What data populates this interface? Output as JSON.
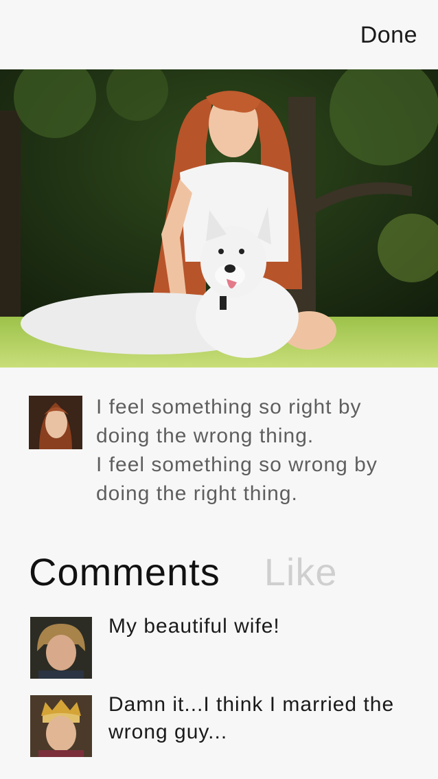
{
  "nav": {
    "done_label": "Done"
  },
  "photo": {
    "description_icon": "photo-woman-with-white-dog"
  },
  "post": {
    "avatar_icon": "avatar-icon",
    "text": "I feel something so right by\ndoing the wrong thing.\nI feel something so wrong by\ndoing the right thing."
  },
  "tabs": {
    "comments_label": "Comments",
    "like_label": "Like"
  },
  "comments": [
    {
      "avatar_icon": "avatar-icon",
      "text": "My beautiful wife!"
    },
    {
      "avatar_icon": "avatar-icon",
      "text": "Damn it...I think I married the wrong guy..."
    }
  ],
  "colors": {
    "background": "#f7f7f7",
    "post_text": "#5e5e5e",
    "tab_active": "#111111",
    "tab_inactive": "#cfcfcf"
  }
}
